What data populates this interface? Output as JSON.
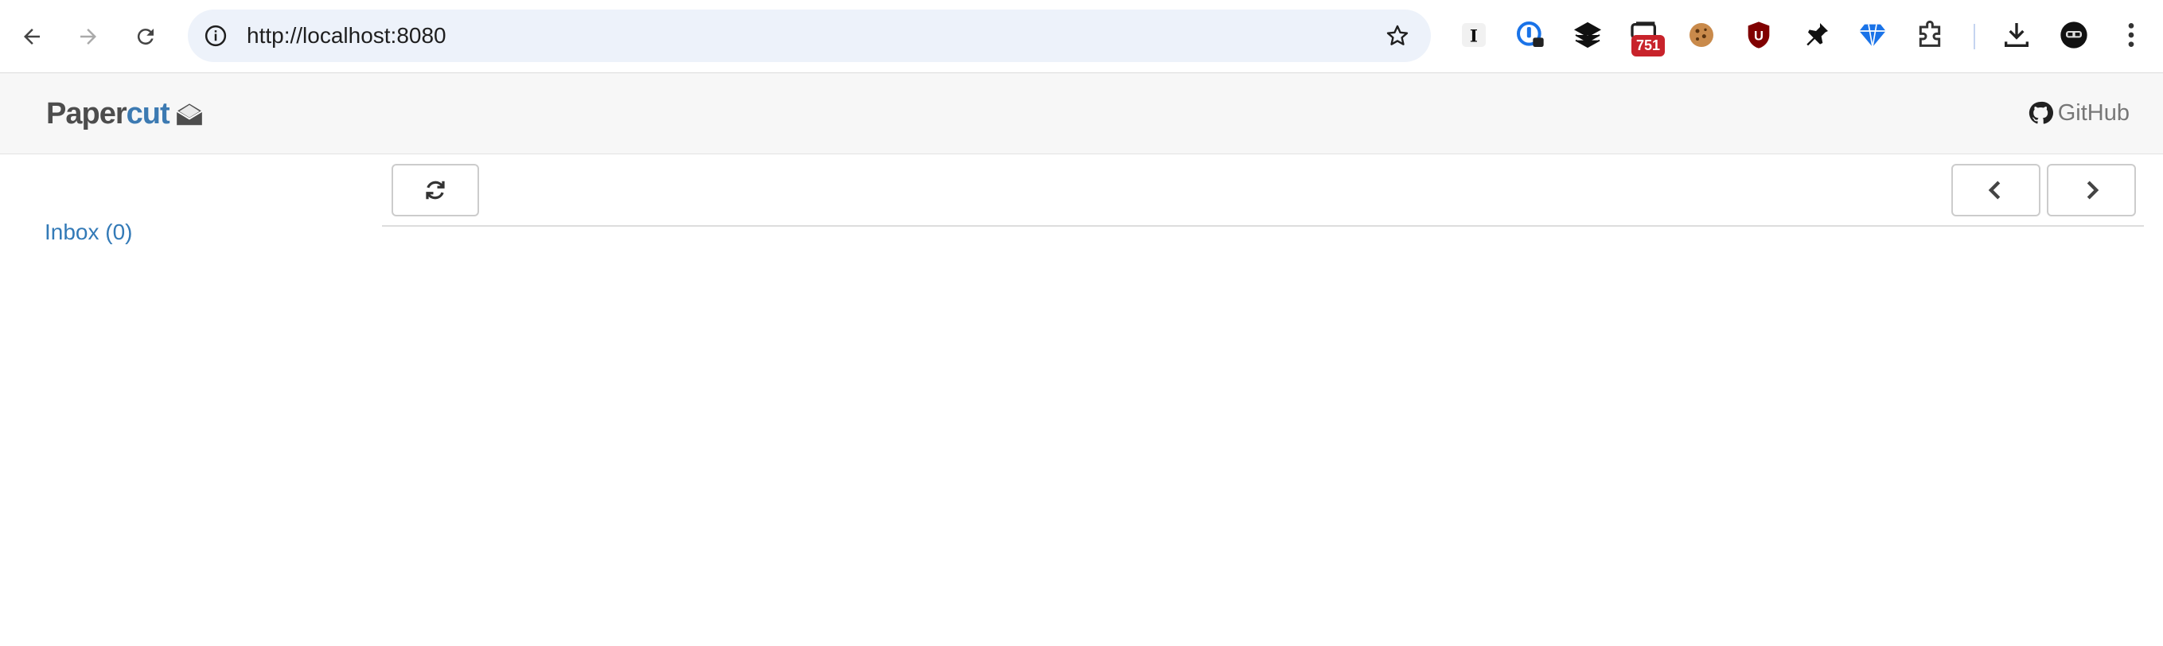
{
  "browser": {
    "url": "http://localhost:8080",
    "extension_badge": "751"
  },
  "app": {
    "logo_part1": "Paper",
    "logo_part2": "cut",
    "github_label": "GitHub",
    "brand_color": "#3c7ab2"
  },
  "sidebar": {
    "inbox_label": "Inbox (0)"
  }
}
